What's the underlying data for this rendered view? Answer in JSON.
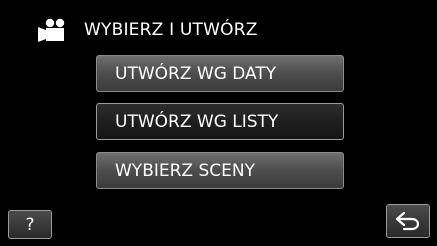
{
  "header": {
    "icon": "video-camera-icon",
    "title": "WYBIERZ I UTWÓRZ"
  },
  "menu": {
    "items": [
      {
        "label": "UTWÓRZ WG DATY",
        "selected": false
      },
      {
        "label": "UTWÓRZ WG LISTY",
        "selected": true
      },
      {
        "label": "WYBIERZ SCENY",
        "selected": false
      }
    ]
  },
  "footer": {
    "help_label": "?",
    "back_icon": "return-arrow-icon"
  },
  "colors": {
    "background": "#000000",
    "text": "#ffffff",
    "button_normal": "#555555",
    "button_selected": "#1f1f1f"
  }
}
